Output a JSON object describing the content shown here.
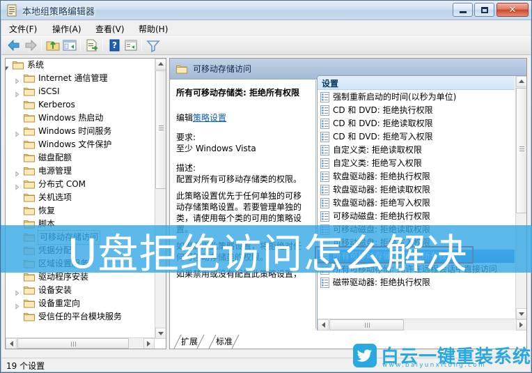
{
  "window": {
    "title": "本地组策略编辑器",
    "icon": "policy-editor-icon",
    "minimize_label": "最小化",
    "maximize_label": "最大化",
    "close_label": "关闭"
  },
  "menu": [
    {
      "label": "文件(F)",
      "text": "文件",
      "accel": "F"
    },
    {
      "label": "操作(A)",
      "text": "操作",
      "accel": "A"
    },
    {
      "label": "查看(V)",
      "text": "查看",
      "accel": "V"
    },
    {
      "label": "帮助(H)",
      "text": "帮助",
      "accel": "H"
    }
  ],
  "toolbar": [
    {
      "name": "back-icon"
    },
    {
      "name": "forward-icon"
    },
    {
      "name": "up-folder-icon"
    },
    {
      "name": "show-console-tree-icon"
    },
    {
      "name": "export-list-icon"
    },
    {
      "name": "help-icon"
    },
    {
      "name": "properties-icon"
    },
    {
      "name": "filter-icon"
    }
  ],
  "tree": {
    "items": [
      {
        "label": "系统",
        "depth": 0,
        "expander": "expanded",
        "selected": false
      },
      {
        "label": "Internet 通信管理",
        "depth": 1,
        "expander": "collapsed",
        "selected": false
      },
      {
        "label": "iSCSI",
        "depth": 1,
        "expander": "collapsed",
        "selected": false
      },
      {
        "label": "Kerberos",
        "depth": 1,
        "expander": "none",
        "selected": false
      },
      {
        "label": "Windows 热启动",
        "depth": 1,
        "expander": "none",
        "selected": false
      },
      {
        "label": "Windows 时间服务",
        "depth": 1,
        "expander": "collapsed",
        "selected": false
      },
      {
        "label": "Windows 文件保护",
        "depth": 1,
        "expander": "none",
        "selected": false
      },
      {
        "label": "磁盘配额",
        "depth": 1,
        "expander": "none",
        "selected": false
      },
      {
        "label": "电源管理",
        "depth": 1,
        "expander": "collapsed",
        "selected": false
      },
      {
        "label": "分布式 COM",
        "depth": 1,
        "expander": "collapsed",
        "selected": false
      },
      {
        "label": "关机选项",
        "depth": 1,
        "expander": "none",
        "selected": false
      },
      {
        "label": "恢复",
        "depth": 1,
        "expander": "none",
        "selected": false
      },
      {
        "label": "脚本",
        "depth": 1,
        "expander": "none",
        "selected": false
      },
      {
        "label": "可移动存储访问",
        "depth": 1,
        "expander": "none",
        "selected": true
      },
      {
        "label": "凭据分配",
        "depth": 1,
        "expander": "none",
        "selected": false
      },
      {
        "label": "区域设置服务",
        "depth": 1,
        "expander": "none",
        "selected": false
      },
      {
        "label": "驱动程序安装",
        "depth": 1,
        "expander": "none",
        "selected": false
      },
      {
        "label": "设备安装",
        "depth": 1,
        "expander": "collapsed",
        "selected": false
      },
      {
        "label": "设备重定向",
        "depth": 1,
        "expander": "collapsed",
        "selected": false
      },
      {
        "label": "受信任的平台模块服务",
        "depth": 1,
        "expander": "none",
        "selected": false
      }
    ]
  },
  "pane": {
    "header_title": "可移动存储访问",
    "header_icon": "folder-icon"
  },
  "extended": {
    "title": "所有可移动存储类: 拒绝所有权限",
    "edit_prefix": "编辑",
    "edit_link": "策略设置",
    "requirement_label": "要求:",
    "requirement_value": "至少 Windows Vista",
    "description_label": "描述:",
    "description_p1": "配置对所有可移动存储类的权限。",
    "description_p2": "此策略设置优先于任何单独的可移动存储策略设置。若要管理单独的类，请使用每个类的可用的策略设置。",
    "description_p3": "如果启用此策略设置，将拒绝对任何可移动存储类的权限。",
    "description_p4": "如果禁用或没有配置此策略设置，"
  },
  "settings": {
    "header": "设置",
    "items": [
      {
        "label": "强制重新启动的时间(以秒为单位)",
        "selected": false
      },
      {
        "label": "CD 和 DVD: 拒绝执行权限",
        "selected": false
      },
      {
        "label": "CD 和 DVD: 拒绝读取权限",
        "selected": false
      },
      {
        "label": "CD 和 DVD: 拒绝写入权限",
        "selected": false
      },
      {
        "label": "自定义类: 拒绝读取权限",
        "selected": false
      },
      {
        "label": "自定义类: 拒绝写入权限",
        "selected": false
      },
      {
        "label": "软盘驱动器: 拒绝执行权限",
        "selected": false
      },
      {
        "label": "软盘驱动器: 拒绝读取权限",
        "selected": false
      },
      {
        "label": "软盘驱动器: 拒绝写入权限",
        "selected": false
      },
      {
        "label": "可移动磁盘: 拒绝执行权限",
        "selected": false
      },
      {
        "label": "可移动磁盘: 拒绝读取权限",
        "selected": false
      },
      {
        "label": "可移动磁盘: 拒绝写入权限",
        "selected": false
      },
      {
        "label": "所有可移动存储类: 拒绝所有权限",
        "selected": true
      },
      {
        "label": "所有可移动存储: 允许在远程会话中直接访问",
        "selected": false
      },
      {
        "label": "磁带驱动器: 拒绝执行权限",
        "selected": false
      }
    ]
  },
  "tabs": [
    {
      "label": "扩展",
      "active": false
    },
    {
      "label": "标准",
      "active": true
    }
  ],
  "status": {
    "text": "19 个设置"
  },
  "banner": {
    "text": "U盘拒绝访问怎么解决",
    "color": "#36a7e6"
  },
  "watermark": {
    "brand": "白云一键重装系统",
    "url": "www.baiyunxitong.com",
    "color": "#2aa9e0",
    "icon": "twitter-bird-icon"
  }
}
